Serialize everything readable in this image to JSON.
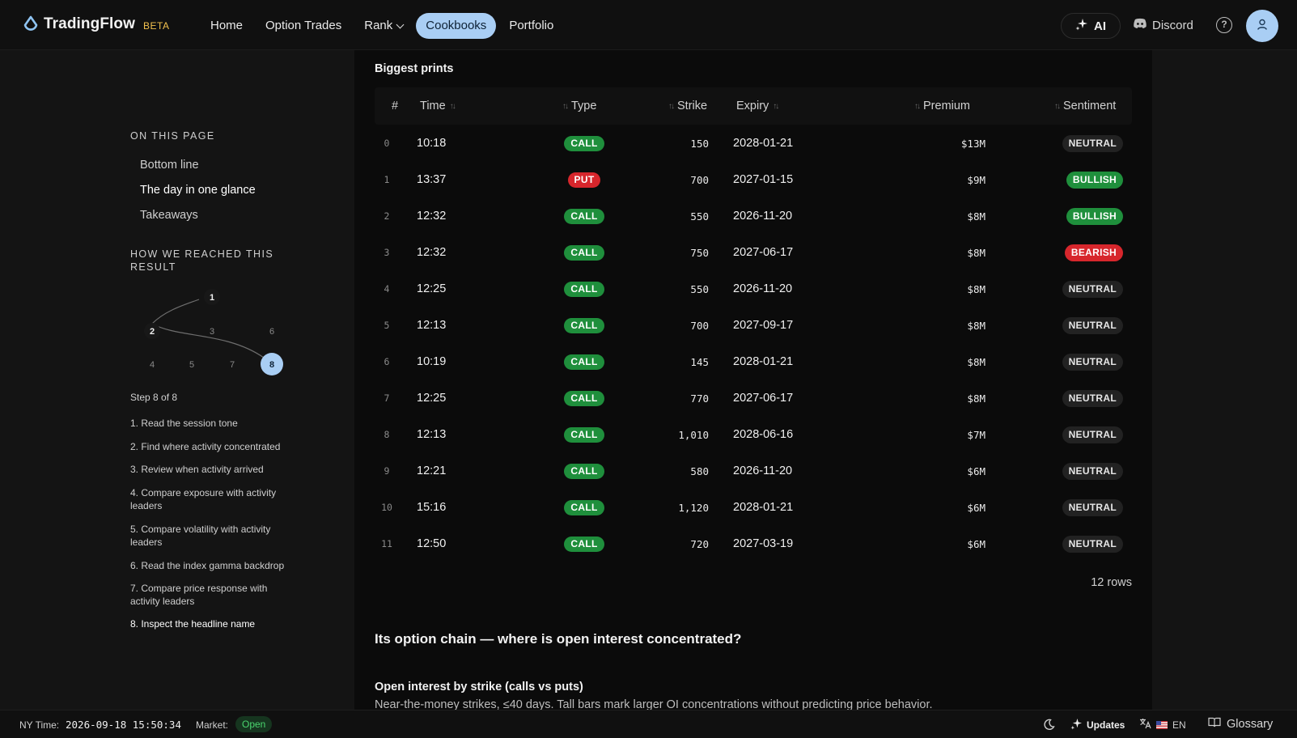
{
  "header": {
    "logo_text": "TradingFlow",
    "beta_label": "BETA",
    "nav": [
      "Home",
      "Option Trades",
      "Rank",
      "Cookbooks",
      "Portfolio"
    ],
    "active_nav": "Cookbooks",
    "ai_label": "AI",
    "discord_label": "Discord"
  },
  "sidebar": {
    "toc_heading": "ON THIS PAGE",
    "toc_items": [
      "Bottom line",
      "The day in one glance",
      "Takeaways"
    ],
    "toc_active": "The day in one glance",
    "how_heading": "HOW WE REACHED THIS RESULT",
    "graph_nodes": [
      "1",
      "2",
      "3",
      "6",
      "4",
      "5",
      "7",
      "8"
    ],
    "graph_active": "8",
    "step_label": "Step 8 of 8",
    "steps": [
      "1.  Read the session tone",
      "2.  Find where activity concentrated",
      "3.  Review when activity arrived",
      "4.  Compare exposure with activity leaders",
      "5.  Compare volatility with activity leaders",
      "6.  Read the index gamma backdrop",
      "7.  Compare price response with activity leaders",
      "8.  Inspect the headline name"
    ]
  },
  "prints": {
    "title": "Biggest prints",
    "columns": [
      "#",
      "Time",
      "Type",
      "Strike",
      "Expiry",
      "Premium",
      "Sentiment"
    ],
    "rows": [
      {
        "idx": "0",
        "time": "10:18",
        "type": "CALL",
        "strike": "150",
        "expiry": "2028-01-21",
        "premium": "$13M",
        "sentiment": "NEUTRAL"
      },
      {
        "idx": "1",
        "time": "13:37",
        "type": "PUT",
        "strike": "700",
        "expiry": "2027-01-15",
        "premium": "$9M",
        "sentiment": "BULLISH"
      },
      {
        "idx": "2",
        "time": "12:32",
        "type": "CALL",
        "strike": "550",
        "expiry": "2026-11-20",
        "premium": "$8M",
        "sentiment": "BULLISH"
      },
      {
        "idx": "3",
        "time": "12:32",
        "type": "CALL",
        "strike": "750",
        "expiry": "2027-06-17",
        "premium": "$8M",
        "sentiment": "BEARISH"
      },
      {
        "idx": "4",
        "time": "12:25",
        "type": "CALL",
        "strike": "550",
        "expiry": "2026-11-20",
        "premium": "$8M",
        "sentiment": "NEUTRAL"
      },
      {
        "idx": "5",
        "time": "12:13",
        "type": "CALL",
        "strike": "700",
        "expiry": "2027-09-17",
        "premium": "$8M",
        "sentiment": "NEUTRAL"
      },
      {
        "idx": "6",
        "time": "10:19",
        "type": "CALL",
        "strike": "145",
        "expiry": "2028-01-21",
        "premium": "$8M",
        "sentiment": "NEUTRAL"
      },
      {
        "idx": "7",
        "time": "12:25",
        "type": "CALL",
        "strike": "770",
        "expiry": "2027-06-17",
        "premium": "$8M",
        "sentiment": "NEUTRAL"
      },
      {
        "idx": "8",
        "time": "12:13",
        "type": "CALL",
        "strike": "1,010",
        "expiry": "2028-06-16",
        "premium": "$7M",
        "sentiment": "NEUTRAL"
      },
      {
        "idx": "9",
        "time": "12:21",
        "type": "CALL",
        "strike": "580",
        "expiry": "2026-11-20",
        "premium": "$6M",
        "sentiment": "NEUTRAL"
      },
      {
        "idx": "10",
        "time": "15:16",
        "type": "CALL",
        "strike": "1,120",
        "expiry": "2028-01-21",
        "premium": "$6M",
        "sentiment": "NEUTRAL"
      },
      {
        "idx": "11",
        "time": "12:50",
        "type": "CALL",
        "strike": "720",
        "expiry": "2027-03-19",
        "premium": "$6M",
        "sentiment": "NEUTRAL"
      }
    ],
    "row_count": "12 rows"
  },
  "option_chain": {
    "title": "Its option chain — where is open interest concentrated?",
    "subtitle": "Open interest by strike (calls vs puts)",
    "description": "Near-the-money strikes, ≤40 days. Tall bars mark larger OI concentrations without predicting price behavior."
  },
  "status_bar": {
    "ny_label": "NY Time:",
    "ny_time": "2026-09-18 15:50:34",
    "market_label": "Market:",
    "market_status": "Open",
    "updates_label": "Updates",
    "lang_label": "EN",
    "glossary_label": "Glossary"
  },
  "colors": {
    "accent": "#a9cef4",
    "call": "#1f8f3c",
    "put": "#d7262c",
    "beta": "#f2c14e"
  }
}
